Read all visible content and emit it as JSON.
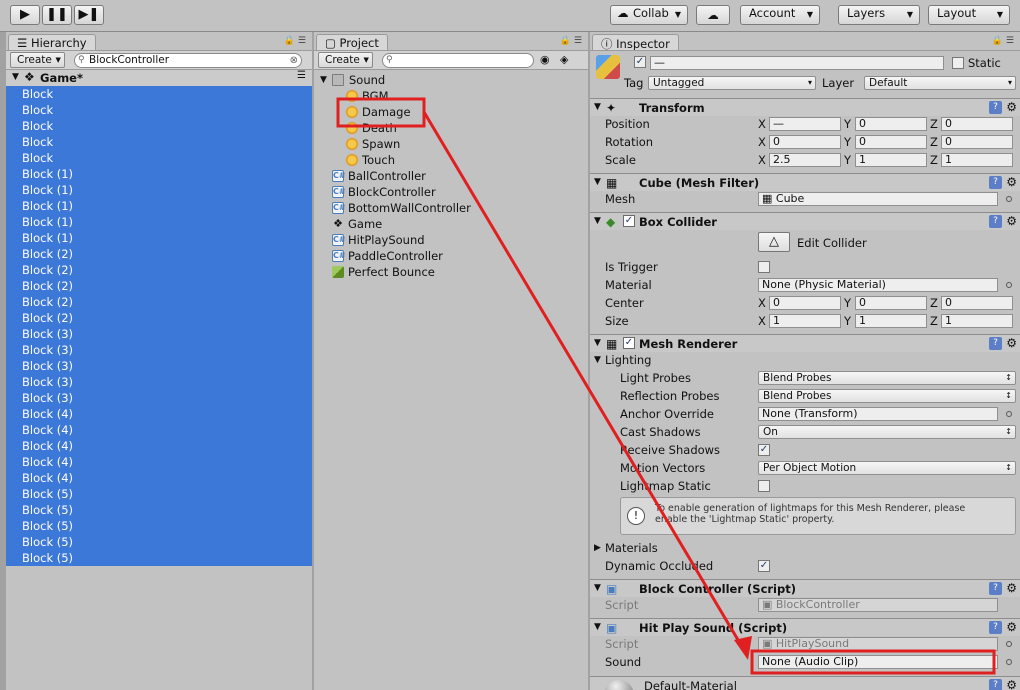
{
  "toolbar": {
    "play_icon": "play-icon",
    "pause_icon": "pause-icon",
    "step_icon": "step-icon",
    "collab_label": "Collab",
    "cloud_icon": "cloud-icon",
    "account_label": "Account",
    "layers_label": "Layers",
    "layout_label": "Layout"
  },
  "hierarchy": {
    "tab_label": "Hierarchy",
    "create_label": "Create",
    "search_value": "BlockController",
    "scene_name": "Game*",
    "rows": [
      "Block",
      "Block",
      "Block",
      "Block",
      "Block",
      "Block (1)",
      "Block (1)",
      "Block (1)",
      "Block (1)",
      "Block (1)",
      "Block (2)",
      "Block (2)",
      "Block (2)",
      "Block (2)",
      "Block (2)",
      "Block (3)",
      "Block (3)",
      "Block (3)",
      "Block (3)",
      "Block (3)",
      "Block (4)",
      "Block (4)",
      "Block (4)",
      "Block (4)",
      "Block (4)",
      "Block (5)",
      "Block (5)",
      "Block (5)",
      "Block (5)",
      "Block (5)"
    ]
  },
  "project": {
    "tab_label": "Project",
    "create_label": "Create",
    "folder": "Sound",
    "sound_items": [
      "BGM",
      "Damage",
      "Death",
      "Spawn",
      "Touch"
    ],
    "assets": [
      {
        "name": "BallController",
        "icon": "csharp-script-icon"
      },
      {
        "name": "BlockController",
        "icon": "csharp-script-icon"
      },
      {
        "name": "BottomWallController",
        "icon": "csharp-script-icon"
      },
      {
        "name": "Game",
        "icon": "unity-scene-icon"
      },
      {
        "name": "HitPlaySound",
        "icon": "csharp-script-icon"
      },
      {
        "name": "PaddleController",
        "icon": "csharp-script-icon"
      },
      {
        "name": "Perfect Bounce",
        "icon": "physic-material-icon"
      }
    ]
  },
  "inspector": {
    "tab_label": "Inspector",
    "name_value": "—",
    "static_label": "Static",
    "tag_label": "Tag",
    "tag_value": "Untagged",
    "layer_label": "Layer",
    "layer_value": "Default",
    "transform": {
      "title": "Transform",
      "position_label": "Position",
      "rotation_label": "Rotation",
      "scale_label": "Scale",
      "axes": [
        "X",
        "Y",
        "Z"
      ],
      "position": [
        "—",
        "0",
        "0"
      ],
      "rotation": [
        "0",
        "0",
        "0"
      ],
      "scale": [
        "2.5",
        "1",
        "1"
      ]
    },
    "mesh_filter": {
      "title": "Cube (Mesh Filter)",
      "mesh_label": "Mesh",
      "mesh_value": "Cube"
    },
    "box_collider": {
      "title": "Box Collider",
      "edit_label": "Edit Collider",
      "is_trigger_label": "Is Trigger",
      "material_label": "Material",
      "material_value": "None (Physic Material)",
      "center_label": "Center",
      "center": [
        "0",
        "0",
        "0"
      ],
      "size_label": "Size",
      "size": [
        "1",
        "1",
        "1"
      ]
    },
    "mesh_renderer": {
      "title": "Mesh Renderer",
      "lighting_label": "Lighting",
      "light_probes_label": "Light Probes",
      "light_probes_value": "Blend Probes",
      "reflection_probes_label": "Reflection Probes",
      "reflection_probes_value": "Blend Probes",
      "anchor_override_label": "Anchor Override",
      "anchor_override_value": "None (Transform)",
      "cast_shadows_label": "Cast Shadows",
      "cast_shadows_value": "On",
      "receive_shadows_label": "Receive Shadows",
      "motion_vectors_label": "Motion Vectors",
      "motion_vectors_value": "Per Object Motion",
      "lightmap_static_label": "Lightmap Static",
      "info_text": "To enable generation of lightmaps for this Mesh Renderer, please enable the 'Lightmap Static' property.",
      "materials_label": "Materials",
      "dynamic_occluded_label": "Dynamic Occluded"
    },
    "block_controller": {
      "title": "Block Controller (Script)",
      "script_label": "Script",
      "script_value": "BlockController"
    },
    "hit_play_sound": {
      "title": "Hit Play Sound (Script)",
      "script_label": "Script",
      "script_value": "HitPlaySound",
      "sound_label": "Sound",
      "sound_value": "None (Audio Clip)"
    },
    "default_material_label": "Default-Material"
  },
  "annotation": {
    "color": "#e02020"
  }
}
